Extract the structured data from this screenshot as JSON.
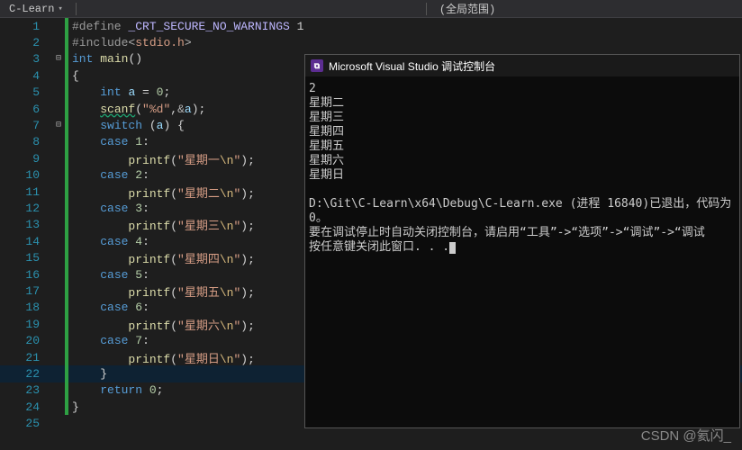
{
  "toolbar": {
    "tab": "C-Learn",
    "scope": "(全局范围)"
  },
  "code": {
    "lines": [
      {
        "n": 1,
        "bar": true,
        "fold": "",
        "segs": [
          [
            "pp",
            "#define "
          ],
          [
            "mac",
            "_CRT_SECURE_NO_WARNINGS"
          ],
          [
            "pun",
            " 1"
          ]
        ]
      },
      {
        "n": 2,
        "bar": true,
        "fold": "",
        "segs": [
          [
            "pp",
            "#include"
          ],
          [
            "pun2",
            "<"
          ],
          [
            "str",
            "stdio.h"
          ],
          [
            "pun2",
            ">"
          ]
        ]
      },
      {
        "n": 3,
        "bar": true,
        "fold": "⊟",
        "segs": [
          [
            "type",
            "int"
          ],
          [
            "pun",
            " "
          ],
          [
            "fn",
            "main"
          ],
          [
            "pun",
            "()"
          ]
        ]
      },
      {
        "n": 4,
        "bar": true,
        "fold": "",
        "segs": [
          [
            "pun",
            "{"
          ]
        ]
      },
      {
        "n": 5,
        "bar": true,
        "fold": "",
        "idt": 1,
        "segs": [
          [
            "type",
            "int"
          ],
          [
            "pun",
            " "
          ],
          [
            "var",
            "a"
          ],
          [
            "pun",
            " = "
          ],
          [
            "num",
            "0"
          ],
          [
            "pun",
            ";"
          ]
        ]
      },
      {
        "n": 6,
        "bar": true,
        "fold": "",
        "idt": 1,
        "segs": [
          [
            "scanf",
            "scanf"
          ],
          [
            "pun",
            "("
          ],
          [
            "str",
            "\"%d\""
          ],
          [
            "pun",
            ","
          ],
          [
            "pun2",
            "&"
          ],
          [
            "var",
            "a"
          ],
          [
            "pun",
            ");"
          ]
        ]
      },
      {
        "n": 7,
        "bar": true,
        "fold": "⊟",
        "idt": 1,
        "segs": [
          [
            "kw",
            "switch"
          ],
          [
            "pun",
            " ("
          ],
          [
            "var",
            "a"
          ],
          [
            "pun",
            ") {"
          ]
        ]
      },
      {
        "n": 8,
        "bar": true,
        "fold": "",
        "idt": 1,
        "segs": [
          [
            "kw",
            "case"
          ],
          [
            "pun",
            " "
          ],
          [
            "num",
            "1"
          ],
          [
            "pun",
            ":"
          ]
        ]
      },
      {
        "n": 9,
        "bar": true,
        "fold": "",
        "idt": 2,
        "segs": [
          [
            "fn",
            "printf"
          ],
          [
            "pun",
            "("
          ],
          [
            "str",
            "\"星期一"
          ],
          [
            "esc",
            "\\n"
          ],
          [
            "str",
            "\""
          ],
          [
            "pun",
            ");"
          ]
        ]
      },
      {
        "n": 10,
        "bar": true,
        "fold": "",
        "idt": 1,
        "segs": [
          [
            "kw",
            "case"
          ],
          [
            "pun",
            " "
          ],
          [
            "num",
            "2"
          ],
          [
            "pun",
            ":"
          ]
        ]
      },
      {
        "n": 11,
        "bar": true,
        "fold": "",
        "idt": 2,
        "segs": [
          [
            "fn",
            "printf"
          ],
          [
            "pun",
            "("
          ],
          [
            "str",
            "\"星期二"
          ],
          [
            "esc",
            "\\n"
          ],
          [
            "str",
            "\""
          ],
          [
            "pun",
            ");"
          ]
        ]
      },
      {
        "n": 12,
        "bar": true,
        "fold": "",
        "idt": 1,
        "segs": [
          [
            "kw",
            "case"
          ],
          [
            "pun",
            " "
          ],
          [
            "num",
            "3"
          ],
          [
            "pun",
            ":"
          ]
        ]
      },
      {
        "n": 13,
        "bar": true,
        "fold": "",
        "idt": 2,
        "segs": [
          [
            "fn",
            "printf"
          ],
          [
            "pun",
            "("
          ],
          [
            "str",
            "\"星期三"
          ],
          [
            "esc",
            "\\n"
          ],
          [
            "str",
            "\""
          ],
          [
            "pun",
            ");"
          ]
        ]
      },
      {
        "n": 14,
        "bar": true,
        "fold": "",
        "idt": 1,
        "segs": [
          [
            "kw",
            "case"
          ],
          [
            "pun",
            " "
          ],
          [
            "num",
            "4"
          ],
          [
            "pun",
            ":"
          ]
        ]
      },
      {
        "n": 15,
        "bar": true,
        "fold": "",
        "idt": 2,
        "segs": [
          [
            "fn",
            "printf"
          ],
          [
            "pun",
            "("
          ],
          [
            "str",
            "\"星期四"
          ],
          [
            "esc",
            "\\n"
          ],
          [
            "str",
            "\""
          ],
          [
            "pun",
            ");"
          ]
        ]
      },
      {
        "n": 16,
        "bar": true,
        "fold": "",
        "idt": 1,
        "segs": [
          [
            "kw",
            "case"
          ],
          [
            "pun",
            " "
          ],
          [
            "num",
            "5"
          ],
          [
            "pun",
            ":"
          ]
        ]
      },
      {
        "n": 17,
        "bar": true,
        "fold": "",
        "idt": 2,
        "segs": [
          [
            "fn",
            "printf"
          ],
          [
            "pun",
            "("
          ],
          [
            "str",
            "\"星期五"
          ],
          [
            "esc",
            "\\n"
          ],
          [
            "str",
            "\""
          ],
          [
            "pun",
            ");"
          ]
        ]
      },
      {
        "n": 18,
        "bar": true,
        "fold": "",
        "idt": 1,
        "segs": [
          [
            "kw",
            "case"
          ],
          [
            "pun",
            " "
          ],
          [
            "num",
            "6"
          ],
          [
            "pun",
            ":"
          ]
        ]
      },
      {
        "n": 19,
        "bar": true,
        "fold": "",
        "idt": 2,
        "segs": [
          [
            "fn",
            "printf"
          ],
          [
            "pun",
            "("
          ],
          [
            "str",
            "\"星期六"
          ],
          [
            "esc",
            "\\n"
          ],
          [
            "str",
            "\""
          ],
          [
            "pun",
            ");"
          ]
        ]
      },
      {
        "n": 20,
        "bar": true,
        "fold": "",
        "idt": 1,
        "segs": [
          [
            "kw",
            "case"
          ],
          [
            "pun",
            " "
          ],
          [
            "num",
            "7"
          ],
          [
            "pun",
            ":"
          ]
        ]
      },
      {
        "n": 21,
        "bar": true,
        "fold": "",
        "idt": 2,
        "segs": [
          [
            "fn",
            "printf"
          ],
          [
            "pun",
            "("
          ],
          [
            "str",
            "\"星期日"
          ],
          [
            "esc",
            "\\n"
          ],
          [
            "str",
            "\""
          ],
          [
            "pun",
            ");"
          ]
        ]
      },
      {
        "n": 22,
        "bar": true,
        "fold": "",
        "idt": 1,
        "hl": true,
        "segs": [
          [
            "pun",
            "}"
          ]
        ]
      },
      {
        "n": 23,
        "bar": true,
        "fold": "",
        "idt": 1,
        "segs": [
          [
            "kw",
            "return"
          ],
          [
            "pun",
            " "
          ],
          [
            "num",
            "0"
          ],
          [
            "pun",
            ";"
          ]
        ]
      },
      {
        "n": 24,
        "bar": true,
        "fold": "",
        "segs": [
          [
            "pun",
            "}"
          ]
        ]
      },
      {
        "n": 25,
        "bar": false,
        "fold": "",
        "segs": []
      }
    ]
  },
  "console": {
    "title": "Microsoft Visual Studio 调试控制台",
    "out_lines": [
      "2",
      "星期二",
      "星期三",
      "星期四",
      "星期五",
      "星期六",
      "星期日"
    ],
    "footer_lines": [
      "D:\\Git\\C-Learn\\x64\\Debug\\C-Learn.exe (进程 16840)已退出，代码为 0。",
      "要在调试停止时自动关闭控制台，请启用“工具”->“选项”->“调试”->“调试",
      "按任意键关闭此窗口. . ."
    ]
  },
  "watermark": "CSDN @氦闪_"
}
